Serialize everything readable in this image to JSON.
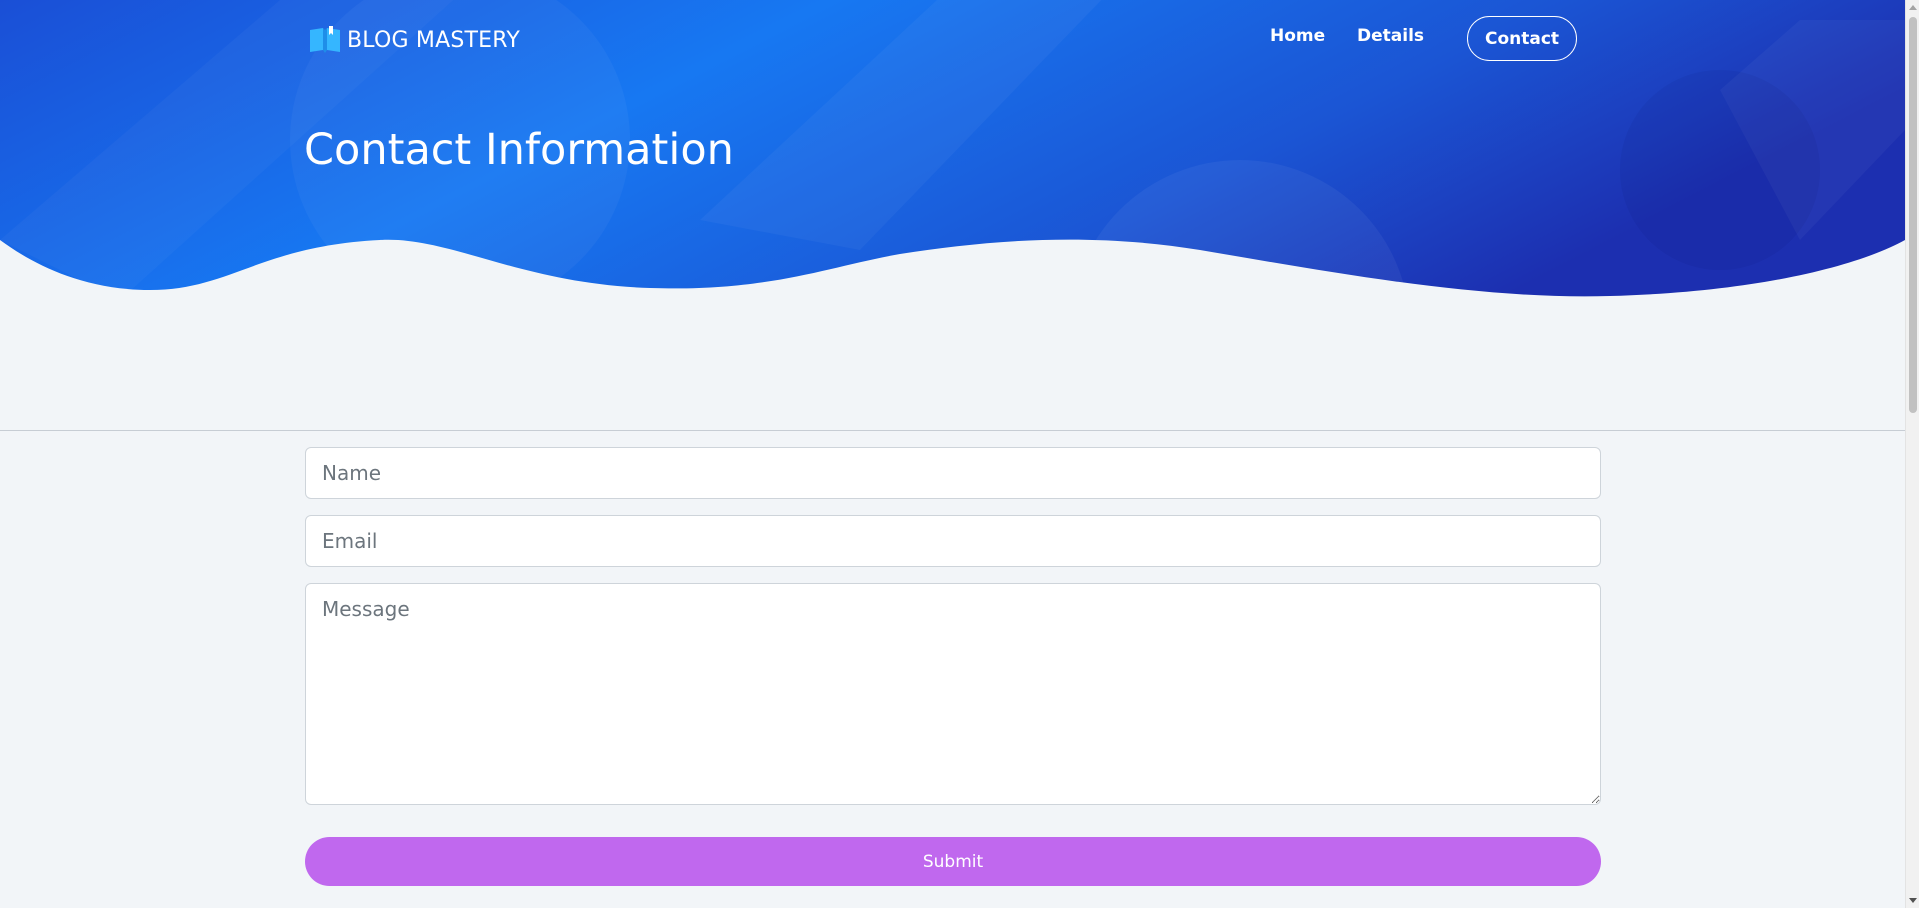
{
  "brand": {
    "name": "BLOG MASTERY",
    "icon": "open-book-icon"
  },
  "nav": {
    "home": "Home",
    "details": "Details",
    "contact": "Contact"
  },
  "hero": {
    "title": "Contact Information"
  },
  "form": {
    "name_placeholder": "Name",
    "email_placeholder": "Email",
    "message_placeholder": "Message",
    "submit_label": "Submit"
  },
  "colors": {
    "hero_gradient_start": "#1a4fd6",
    "hero_gradient_mid": "#1778f2",
    "hero_gradient_end": "#1c2fb0",
    "submit": "#c068ee",
    "background": "#f2f5f8",
    "brand_icon": "#35b6ff"
  }
}
